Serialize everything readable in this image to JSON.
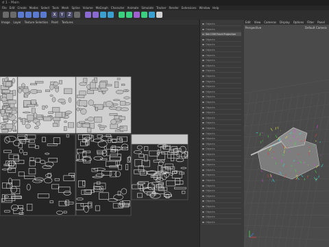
{
  "window": {
    "title": "d 1 - Main"
  },
  "menu": [
    "File",
    "Edit",
    "Create",
    "Modes",
    "Select",
    "Tools",
    "Mesh",
    "Spline",
    "Volume",
    "MoGraph",
    "Character",
    "Animate",
    "Simulate",
    "Tracker",
    "Render",
    "Extensions",
    "Window",
    "Help"
  ],
  "toolbar": {
    "buttons": [
      {
        "name": "undo-icon",
        "color": "#6a6a6a"
      },
      {
        "name": "redo-icon",
        "color": "#6a6a6a"
      },
      {
        "name": "live-selection-icon",
        "color": "#5a7ad0"
      },
      {
        "name": "move-icon",
        "color": "#5a7ad0"
      },
      {
        "name": "scale-icon",
        "color": "#5a7ad0"
      },
      {
        "name": "rotate-icon",
        "color": "#5a7ad0"
      },
      {
        "name": "x-axis-icon",
        "color": "#4a4a6a",
        "label": "X"
      },
      {
        "name": "y-axis-icon",
        "color": "#4a4a6a",
        "label": "Y"
      },
      {
        "name": "z-axis-icon",
        "color": "#4a4a6a",
        "label": "Z"
      },
      {
        "name": "coordinate-icon",
        "color": "#6a6a6a"
      },
      {
        "name": "render-view-icon",
        "color": "#8a6ad0"
      },
      {
        "name": "render-settings-icon",
        "color": "#8a6ad0"
      },
      {
        "name": "cube-icon",
        "color": "#3aa0d0"
      },
      {
        "name": "pen-icon",
        "color": "#3aa0d0"
      },
      {
        "name": "subdivision-icon",
        "color": "#3ad080"
      },
      {
        "name": "cloner-icon",
        "color": "#3ad080"
      },
      {
        "name": "deformer-icon",
        "color": "#a060d0"
      },
      {
        "name": "environment-icon",
        "color": "#3ad080"
      },
      {
        "name": "camera-icon",
        "color": "#3aa0d0"
      },
      {
        "name": "light-icon",
        "color": "#d0d0d0"
      }
    ]
  },
  "uv_editor": {
    "menu": [
      "Image",
      "Layer",
      "Texture Selection",
      "Paint",
      "Textures"
    ]
  },
  "objects": {
    "rows": [
      "Objects",
      "Objects",
      "Set CSM Front Projection",
      "Objects",
      "Objects",
      "Objects",
      "Objects",
      "Objects",
      "Objects",
      "Objects",
      "Objects",
      "Objects",
      "Objects",
      "Objects",
      "Objects",
      "Objects",
      "Objects",
      "Objects",
      "Objects",
      "Objects",
      "Objects",
      "Objects",
      "Objects",
      "Objects",
      "Objects",
      "Objects",
      "Objects",
      "Objects",
      "Objects",
      "Objects",
      "Objects",
      "Objects",
      "Objects",
      "Objects",
      "Objects",
      "Objects",
      "Objects",
      "Objects",
      "Objects"
    ]
  },
  "viewport": {
    "menu": [
      "Edit",
      "View",
      "Cameras",
      "Display",
      "Options",
      "Filter",
      "Panel"
    ],
    "label": "Perspective",
    "camera": "Default Camera"
  }
}
